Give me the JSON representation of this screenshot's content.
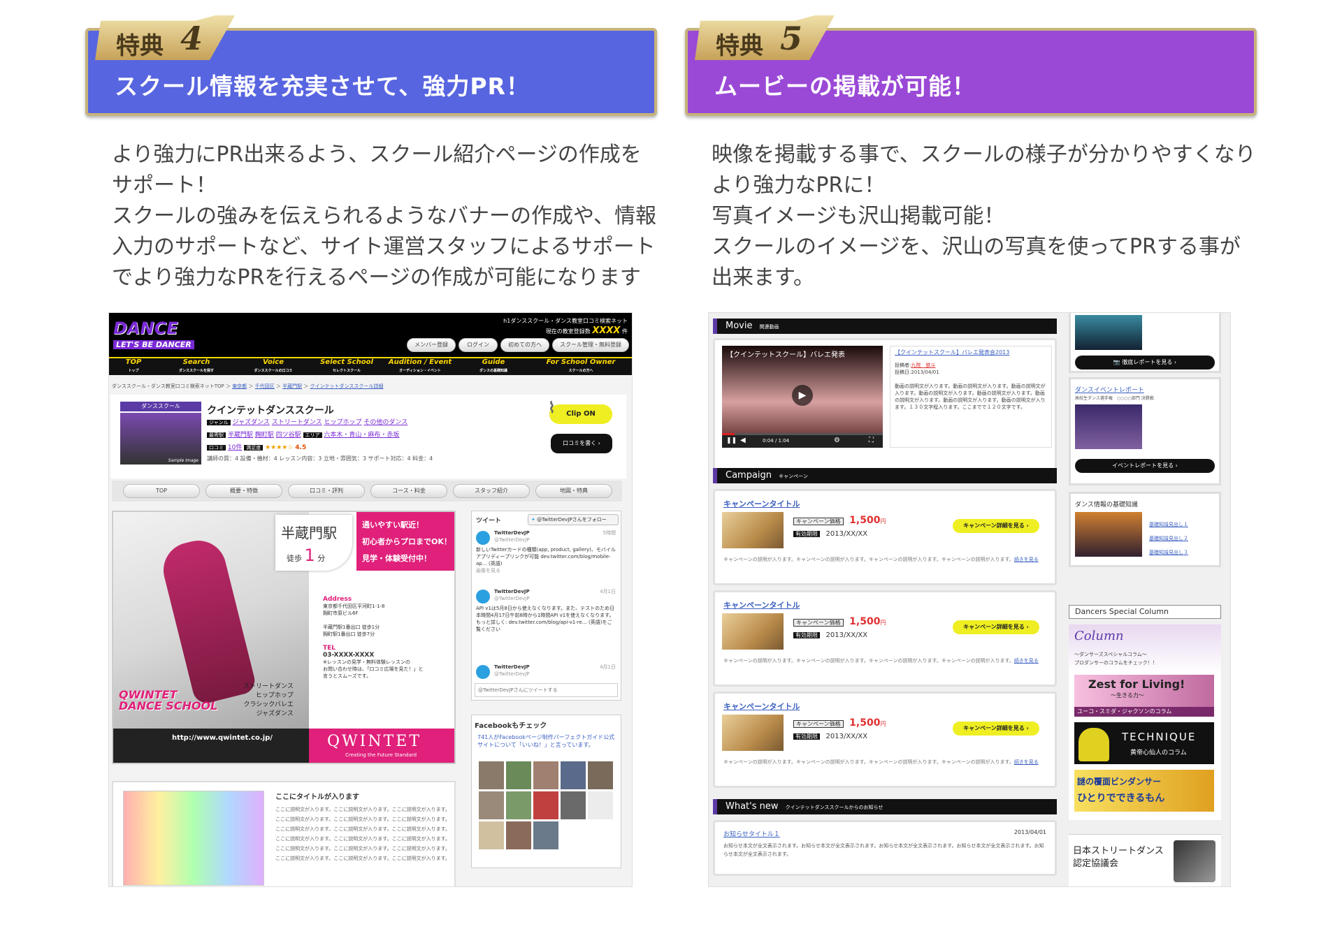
{
  "left": {
    "tab_label": "特典",
    "tab_number": "4",
    "title": "スクール情報を充実させて、強力PR！",
    "header_color": "#5865e0",
    "paragraph": [
      "より強力にPR出来るよう、スクール紹介ページの作成を",
      "サポート！",
      "スクールの強みを伝えられるようなバナーの作成や、情報",
      "入力のサポートなど、サイト運営スタッフによるサポート",
      "でより強力なPRを行えるページの作成が可能になります"
    ],
    "shot": {
      "logo_line1": "DANCE",
      "logo_line2": "LET'S BE DANCER",
      "site_desc": "h1ダンススクール・ダンス教室口コミ検索ネット",
      "count_label": "現在の教室登録数",
      "count_value": "XXXX",
      "count_unit": "件",
      "top_buttons": [
        "メンバー登録",
        "ログイン",
        "初めての方へ",
        "スクール管理・無料登録"
      ],
      "gnav": [
        {
          "en": "TOP",
          "ja": "トップ"
        },
        {
          "en": "Search",
          "ja": "ダンススクールを探す"
        },
        {
          "en": "Voice",
          "ja": "ダンススクールの口コミ"
        },
        {
          "en": "Select School",
          "ja": "セレクトスクール"
        },
        {
          "en": "Audition / Event",
          "ja": "オーディション・イベント"
        },
        {
          "en": "Guide",
          "ja": "ダンスの基礎知識"
        },
        {
          "en": "For School Owner",
          "ja": "スクールの方へ"
        }
      ],
      "breadcrumb": [
        "ダンススクール・ダンス教室口コミ検索ネットTOP",
        "東京都",
        "千代田区",
        "半蔵門駅",
        "クインテットダンススクール詳細"
      ],
      "school_badge": "ダンススクール",
      "school_name": "クインテットダンススクール",
      "genre_label": "ジャンル",
      "genres": [
        "ジャズダンス",
        "ストリートダンス",
        "ヒップホップ",
        "その他のダンス"
      ],
      "station_label": "最寄駅",
      "stations": [
        "半蔵門駅",
        "麹町駅",
        "四ツ谷駅"
      ],
      "area_label": "エリア",
      "areas": "六本木・青山・麻布・赤坂",
      "review_label": "口コミ",
      "review_count": "10件",
      "rating_label": "満足度",
      "stars": "★★★★☆",
      "rating": "4.5",
      "scores": "講師の質：4  設備・機材：4  レッスン内容：3  立地・雰囲気：3  サポート対応：4  料金：4",
      "clip_label": "Clip ON",
      "review_btn": "口コミを書く",
      "sample_image": "Sample Image",
      "tabs": [
        "TOP",
        "概要・特徴",
        "口コミ・評判",
        "コース・料金",
        "スタッフ紹介",
        "地図・特典"
      ],
      "banner": {
        "station": "半蔵門駅",
        "walk": "徒歩",
        "walk_min": "1",
        "walk_unit": "分",
        "catch": [
          "通いやすい駅近！",
          "初心者からプロまでOK！",
          "見学・体験受付中！"
        ],
        "address_label": "Address",
        "address": [
          "東京都千代田区平河町1-1-8",
          "麹町市原ビル6F"
        ],
        "access": [
          "半蔵門駅1番出口 徒歩1分",
          "麹町駅1番出口 徒歩7分"
        ],
        "tel_label": "TEL",
        "tel": "03-XXXX-XXXX",
        "tel_note": [
          "※レッスンの見学・無料体験レッスンの",
          "お問い合わせ時は、「口コミ広場を見た！」と",
          "言うとスムーズです。"
        ],
        "logo": [
          "QWINTET",
          "DANCE SCHOOL"
        ],
        "genres": [
          "ストリートダンス",
          "ヒップホップ",
          "クラシックバレエ",
          "ジャズダンス"
        ],
        "url": "http://www.qwintet.co.jp/",
        "brand": "QWINTET",
        "brand_sub": "Creating the Future Standard"
      },
      "twitter": {
        "tweets_label": "ツイート",
        "follow": "@TwitterDevJPさんをフォロー",
        "items": [
          {
            "name": "TwitterDevJP",
            "handle": "@TwitterDevJP",
            "time": "5時間",
            "body": "新しいTwitterカードの種類(app, product, gallery)、モバイルアプリディープリンクが可能 dev.twitter.com/blog/mobile-ap… (英語)",
            "more": "画像を見る"
          },
          {
            "name": "TwitterDevJP",
            "handle": "@TwitterDevJP",
            "time": "4月1日",
            "body": "API v1は5月8日から使えなくなります。また、テストのため日本時間4月17日午前8時から1時間API v1を使えなくなります。もっと詳しく: dev.twitter.com/blog/api-v1-re… (英語)をご覧ください",
            "more": ""
          },
          {
            "name": "TwitterDevJP",
            "handle": "@TwitterDevJP",
            "time": "4月1日",
            "body": "",
            "more": ""
          }
        ],
        "input_placeholder": "@TwitterDevJPさんにツイートする"
      },
      "facebook": {
        "title": "Facebookもチェック",
        "body": "741人がFacebookページ制作パーフェクトガイド公式サイトについて「いいね！」と言っています。"
      },
      "article": {
        "title": "ここにタイトルが入ります",
        "body": "ここに説明文が入ります。ここに説明文が入ります。ここに説明文が入ります。ここに説明文が入ります。ここに説明文が入ります。ここに説明文が入ります。ここに説明文が入ります。ここに説明文が入ります。ここに説明文が入ります。ここに説明文が入ります。ここに説明文が入ります。ここに説明文が入ります。ここに説明文が入ります。ここに説明文が入ります。ここに説明文が入ります。ここに説明文が入ります。ここに説明文が入ります。ここに説明文が入ります。"
      }
    }
  },
  "right": {
    "tab_label": "特典",
    "tab_number": "5",
    "title": "ムービーの掲載が可能！",
    "header_color": "#9a49d6",
    "paragraph": [
      "映像を掲載する事で、スクールの様子が分かりやすくなり",
      "より強力なPRに！",
      "写真イメージも沢山掲載可能！",
      "スクールのイメージを、沢山の写真を使ってPRする事が",
      "出来ます。"
    ],
    "shot": {
      "movie_en": "Movie",
      "movie_ja": "関連動画",
      "video_title": "【クインテットスクール】バレエ発表",
      "video_time": "0:04 / 1:04",
      "movie_link": "【クインテットスクール】バレエ発表会2013",
      "poster_label": "投稿者:",
      "poster": "九院　鉄斗",
      "date_label": "投稿日:",
      "date": "2013/04/01",
      "movie_desc": "動画の説明文が入ります。動画の説明文が入ります。動画の説明文が入ります。動画の説明文が入ります。動画の説明文が入ります。動画の説明文が入ります。動画の説明文が入ります。動画の説明文が入ります。１３０文字程入ります。ここまでで１２０文字です。",
      "campaign_en": "Campaign",
      "campaign_ja": "キャンペーン",
      "campaigns": [
        {
          "title": "キャンペーンタイトル",
          "price_label": "キャンペーン価格",
          "price": "1,500",
          "price_unit": "円",
          "period_label": "有効期限",
          "period": "2013/XX/XX",
          "button": "キャンペーン詳細を見る",
          "desc": "キャンペーンの説明が入ります。キャンペーンの説明が入ります。キャンペーンの説明が入ります。キャンペーンの説明が入ります。",
          "more": "続きを見る"
        },
        {
          "title": "キャンペーンタイトル",
          "price_label": "キャンペーン価格",
          "price": "1,500",
          "price_unit": "円",
          "period_label": "有効期限",
          "period": "2013/XX/XX",
          "button": "キャンペーン詳細を見る",
          "desc": "キャンペーンの説明が入ります。キャンペーンの説明が入ります。キャンペーンの説明が入ります。キャンペーンの説明が入ります。",
          "more": "続きを見る"
        },
        {
          "title": "キャンペーンタイトル",
          "price_label": "キャンペーン価格",
          "price": "1,500",
          "price_unit": "円",
          "period_label": "有効期限",
          "period": "2013/XX/XX",
          "button": "キャンペーン詳細を見る",
          "desc": "キャンペーンの説明が入ります。キャンペーンの説明が入ります。キャンペーンの説明が入ります。キャンペーンの説明が入ります。",
          "more": "続きを見る"
        }
      ],
      "news_en": "What's new",
      "news_ja": "クインテットダンススクールからのお知らせ",
      "news_title": "お知らせタイトル１",
      "news_date": "2013/04/01",
      "news_body": "お知らせ本文が全文表示されます。お知らせ本文が全文表示されます。お知らせ本文が全文表示されます。お知らせ本文が全文表示されます。お知らせ本文が全文表示されます。",
      "side": {
        "report_btn": "徹底レポートを見る",
        "event_title": "ダンスイベントレポート",
        "event_sub": "高校生ダンス選手権　○○○○部門 決勝戦",
        "event_btn": "イベントレポートを見る",
        "basics_title": "ダンス情報の基礎知識",
        "basics_links": [
          "基礎知識見出し１",
          "基礎知識見出し２",
          "基礎知識見出し３"
        ],
        "column_header": "Dancers Special Column",
        "column_logo": "Column",
        "column_sub": [
          "〜ダンサーズスペシャルコラム〜",
          "プロダンサーのコラムをチェック！！"
        ],
        "banners": [
          {
            "title": "Zest for Living!",
            "sub": "〜生きる力〜",
            "foot": "ユーコ・スミダ・ジャクソンのコラム"
          },
          {
            "title": "TECHNIQUE",
            "sub": "黄帝心仙人のコラム"
          },
          {
            "title": "謎の覆面ビンダンサー",
            "sub": "ひとりでできるもん"
          }
        ],
        "udac": [
          "日本ストリートダンス",
          "認定協議会"
        ]
      }
    }
  }
}
